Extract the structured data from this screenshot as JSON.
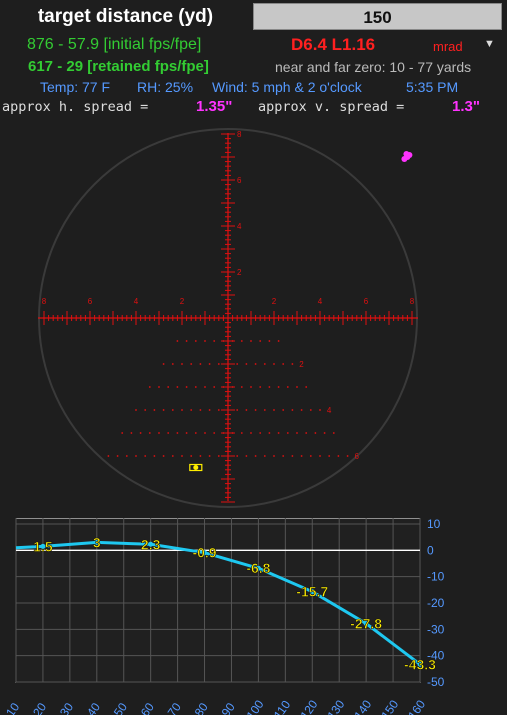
{
  "header": {
    "target_label": "target distance (yd)",
    "target_value": "150"
  },
  "info": {
    "initial": "876 - 57.9 [initial fps/fpe]",
    "retained": "617 - 29 [retained fps/fpe]",
    "drop_wind": "D6.4  L1.16",
    "unit": "mrad",
    "zero_text": "near and far zero: 10  -  77 yards",
    "temp": "Temp: 77 F",
    "rh": "RH: 25%",
    "wind": "Wind: 5 mph & 2 o'clock",
    "time": "5:35 PM",
    "h_spread_label": "approx h. spread =",
    "h_spread_value": "1.35\"",
    "v_spread_label": "approx v. spread =",
    "v_spread_value": "1.3\""
  },
  "colors": {
    "green": "#33cc33",
    "red": "#ff2020",
    "magenta": "#ff33ff",
    "blue": "#5599ff",
    "cyan": "#1ec8f0",
    "yellow": "#ffee00",
    "reticle": "#e01010"
  },
  "reticle": {
    "horizontal_labels": [
      "8",
      "6",
      "4",
      "2",
      "2",
      "4",
      "6",
      "8"
    ],
    "vertical_labels": [
      "8",
      "6",
      "4",
      "2"
    ],
    "hold_labels": [
      "2",
      "4",
      "6"
    ],
    "impact_mil": {
      "x": 7.8,
      "y": 7.0
    },
    "hold_point_mil": {
      "x": -1.4,
      "y": -6.5
    }
  },
  "chart_data": {
    "type": "line",
    "x": [
      10,
      20,
      40,
      60,
      80,
      100,
      120,
      140,
      160
    ],
    "y": [
      1.0,
      1.5,
      3,
      2.3,
      -0.9,
      -6.8,
      -15.7,
      -27.8,
      -43.3
    ],
    "point_labels": [
      {
        "x": 20,
        "y": 1.5,
        "label": "1.5"
      },
      {
        "x": 40,
        "y": 3,
        "label": "3"
      },
      {
        "x": 60,
        "y": 2.3,
        "label": "2.3"
      },
      {
        "x": 80,
        "y": -0.9,
        "label": "-0.9"
      },
      {
        "x": 100,
        "y": -6.8,
        "label": "-6.8"
      },
      {
        "x": 120,
        "y": -15.7,
        "label": "-15.7"
      },
      {
        "x": 140,
        "y": -27.8,
        "label": "-27.8"
      },
      {
        "x": 160,
        "y": -43.3,
        "label": "-43.3"
      }
    ],
    "xticks": [
      "10",
      "20",
      "30",
      "40",
      "50",
      "60",
      "70",
      "80",
      "90",
      "100",
      "110",
      "120",
      "130",
      "140",
      "150",
      "160"
    ],
    "yticks": [
      "10",
      "0",
      "-10",
      "-20",
      "-30",
      "-40",
      "-50"
    ],
    "xlim": [
      10,
      160
    ],
    "ylim": [
      -50,
      10
    ],
    "grid": true
  }
}
